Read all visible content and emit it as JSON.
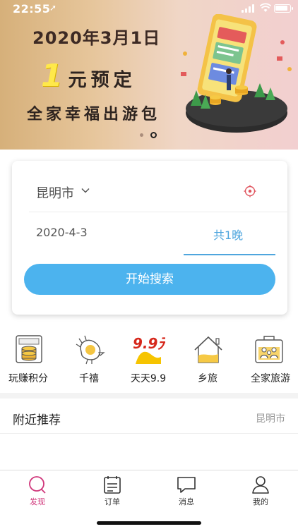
{
  "status_bar": {
    "time": "22:55",
    "location_glyph": "➚"
  },
  "banner": {
    "line1": "2020年3月1日",
    "line2_big": "1",
    "line2_rest": "元预定",
    "line3": "全家幸福出游包",
    "pager": {
      "total": 2,
      "active_index": 1
    }
  },
  "search": {
    "city": "昆明市",
    "date": "2020-4-3",
    "nights": "共1晚",
    "button": "开始搜索"
  },
  "categories": [
    {
      "label": "玩赚积分",
      "icon": "coin-stack-icon"
    },
    {
      "label": "千禧",
      "icon": "bird-icon"
    },
    {
      "label": "天天9.9",
      "icon": "nine-nine-icon",
      "icon_text": "9.9元"
    },
    {
      "label": "乡旅",
      "icon": "house-icon"
    },
    {
      "label": "全家旅游",
      "icon": "family-suitcase-icon"
    }
  ],
  "nearby": {
    "title": "附近推荐",
    "city": "昆明市"
  },
  "tabbar": [
    {
      "label": "发现",
      "icon": "search-icon",
      "active": true
    },
    {
      "label": "订单",
      "icon": "order-icon",
      "active": false
    },
    {
      "label": "消息",
      "icon": "message-icon",
      "active": false
    },
    {
      "label": "我的",
      "icon": "profile-icon",
      "active": false
    }
  ],
  "colors": {
    "accent": "#4cb3ee",
    "tab_active": "#d0377b",
    "nine_red": "#d6281c",
    "nine_yellow": "#f6c400"
  }
}
